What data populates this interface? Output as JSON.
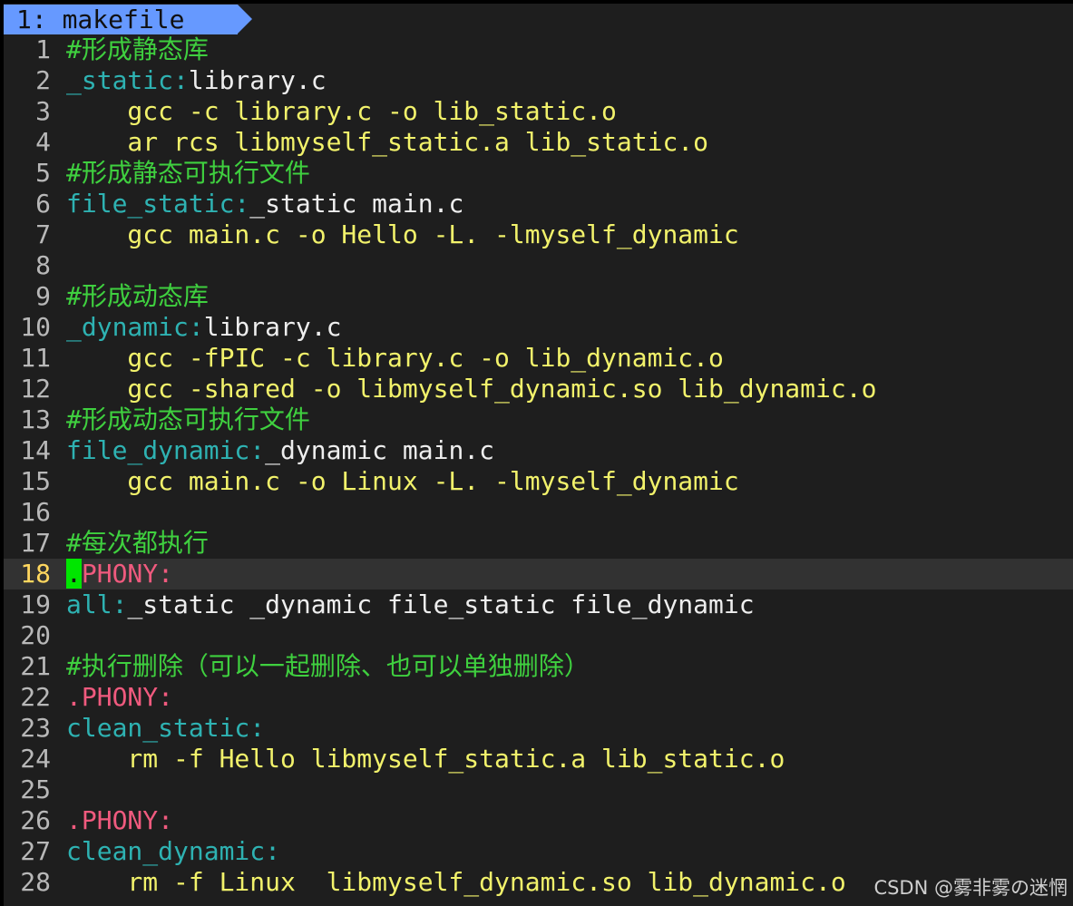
{
  "tab": {
    "label": "1: makefile"
  },
  "editor": {
    "current_line": 18,
    "lines": [
      {
        "n": "1",
        "tokens": [
          {
            "t": "#形成静态库",
            "c": "comment"
          }
        ]
      },
      {
        "n": "2",
        "tokens": [
          {
            "t": "_static:",
            "c": "target"
          },
          {
            "t": "library.c",
            "c": "dep"
          }
        ]
      },
      {
        "n": "3",
        "tokens": [
          {
            "t": "    gcc -c library.c -o lib_static.o",
            "c": "cmd"
          }
        ]
      },
      {
        "n": "4",
        "tokens": [
          {
            "t": "    ar rcs libmyself_static.a lib_static.o",
            "c": "cmd"
          }
        ]
      },
      {
        "n": "5",
        "tokens": [
          {
            "t": "#形成静态可执行文件",
            "c": "comment"
          }
        ]
      },
      {
        "n": "6",
        "tokens": [
          {
            "t": "file_static:",
            "c": "target"
          },
          {
            "t": "_static main.c",
            "c": "dep"
          }
        ]
      },
      {
        "n": "7",
        "tokens": [
          {
            "t": "    gcc main.c -o Hello -L. -lmyself_dynamic",
            "c": "cmd"
          }
        ]
      },
      {
        "n": "8",
        "tokens": []
      },
      {
        "n": "9",
        "tokens": [
          {
            "t": "#形成动态库",
            "c": "comment"
          }
        ]
      },
      {
        "n": "10",
        "tokens": [
          {
            "t": "_dynamic:",
            "c": "target"
          },
          {
            "t": "library.c",
            "c": "dep"
          }
        ]
      },
      {
        "n": "11",
        "tokens": [
          {
            "t": "    gcc -fPIC -c library.c -o lib_dynamic.o",
            "c": "cmd"
          }
        ]
      },
      {
        "n": "12",
        "tokens": [
          {
            "t": "    gcc -shared -o libmyself_dynamic.so lib_dynamic.o",
            "c": "cmd"
          }
        ]
      },
      {
        "n": "13",
        "tokens": [
          {
            "t": "#形成动态可执行文件",
            "c": "comment"
          }
        ]
      },
      {
        "n": "14",
        "tokens": [
          {
            "t": "file_dynamic:",
            "c": "target"
          },
          {
            "t": "_dynamic main.c",
            "c": "dep"
          }
        ]
      },
      {
        "n": "15",
        "tokens": [
          {
            "t": "    gcc main.c -o Linux -L. -lmyself_dynamic",
            "c": "cmd"
          }
        ]
      },
      {
        "n": "16",
        "tokens": []
      },
      {
        "n": "17",
        "tokens": [
          {
            "t": "#每次都执行",
            "c": "comment"
          }
        ]
      },
      {
        "n": "18",
        "tokens": [
          {
            "t": ".",
            "c": "cursor"
          },
          {
            "t": "PHONY:",
            "c": "phony"
          }
        ]
      },
      {
        "n": "19",
        "tokens": [
          {
            "t": "all:",
            "c": "target"
          },
          {
            "t": "_static _dynamic file_static file_dynamic",
            "c": "dep"
          }
        ]
      },
      {
        "n": "20",
        "tokens": []
      },
      {
        "n": "21",
        "tokens": [
          {
            "t": "#执行删除（可以一起删除、也可以单独删除）",
            "c": "comment"
          }
        ]
      },
      {
        "n": "22",
        "tokens": [
          {
            "t": ".PHONY:",
            "c": "phony"
          }
        ]
      },
      {
        "n": "23",
        "tokens": [
          {
            "t": "clean_static:",
            "c": "target"
          }
        ]
      },
      {
        "n": "24",
        "tokens": [
          {
            "t": "    rm -f Hello libmyself_static.a lib_static.o",
            "c": "cmd"
          }
        ]
      },
      {
        "n": "25",
        "tokens": []
      },
      {
        "n": "26",
        "tokens": [
          {
            "t": ".PHONY:",
            "c": "phony"
          }
        ]
      },
      {
        "n": "27",
        "tokens": [
          {
            "t": "clean_dynamic:",
            "c": "target"
          }
        ]
      },
      {
        "n": "28",
        "tokens": [
          {
            "t": "    rm -f Linux  libmyself_dynamic.so lib_dynamic.o",
            "c": "cmd"
          }
        ]
      }
    ]
  },
  "watermark": {
    "text": "CSDN @雾非雾の迷惘"
  },
  "colors": {
    "background": "#1e1e1e",
    "tab_background": "#6699ff",
    "comment": "#3fd03f",
    "target": "#2eb2b2",
    "dependency": "#eeeeee",
    "command": "#f2f26b",
    "phony": "#f05a7e",
    "cursor": "#00e600",
    "line_number": "#b8b8b8",
    "current_line_number": "#ffd75f"
  }
}
